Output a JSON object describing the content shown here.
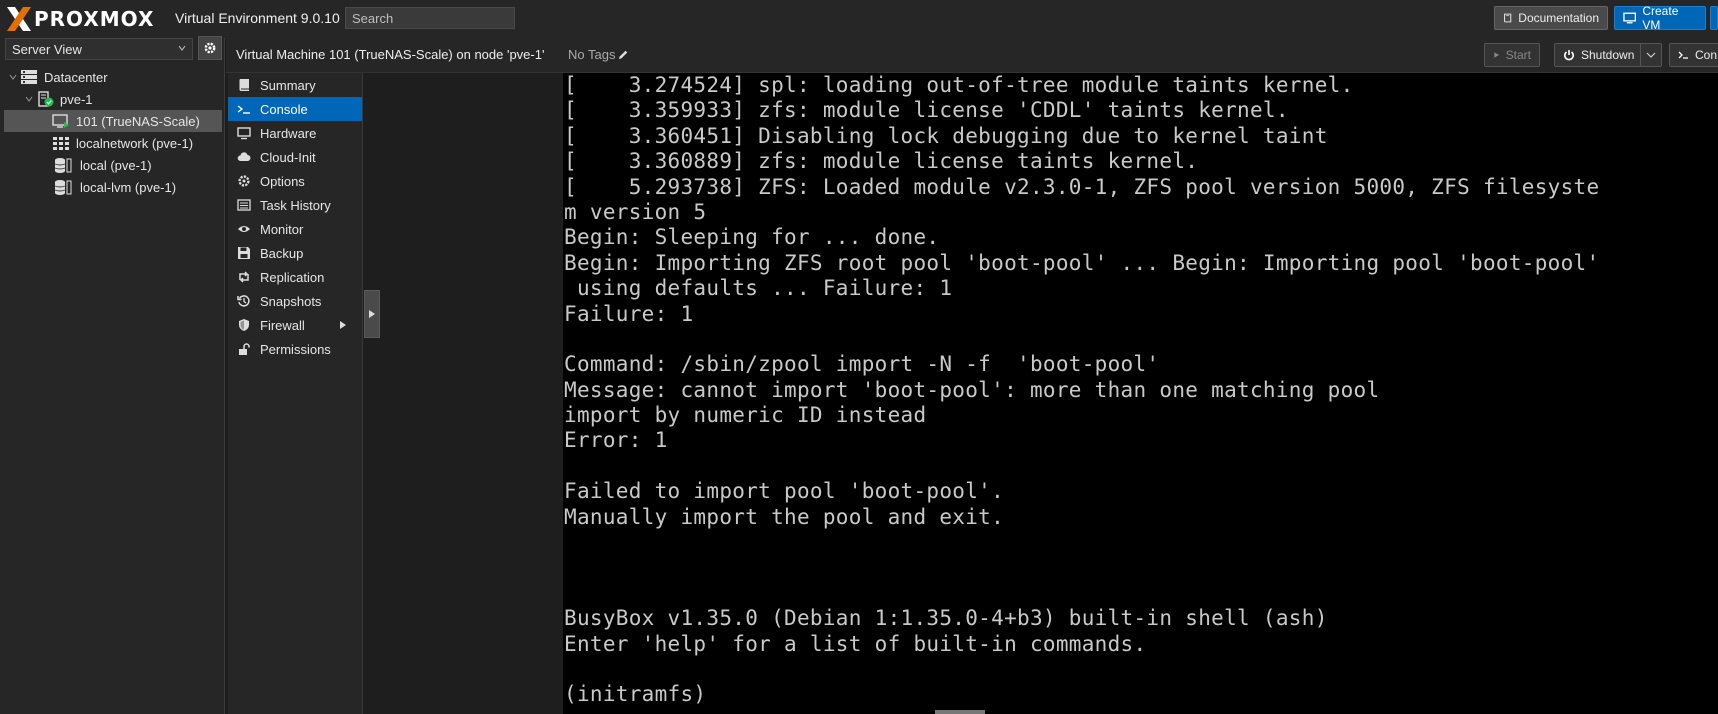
{
  "header": {
    "logo_text": "PROXMOX",
    "product": "Virtual Environment 9.0.10",
    "search_placeholder": "Search",
    "documentation_label": "Documentation",
    "create_vm_label": "Create VM"
  },
  "sidebar": {
    "view_label": "Server View",
    "tree": [
      {
        "label": "Datacenter",
        "icon": "datacenter-icon"
      },
      {
        "label": "pve-1",
        "icon": "node-online-icon"
      },
      {
        "label": "101 (TrueNAS-Scale)",
        "icon": "vm-running-icon",
        "selected": true
      },
      {
        "label": "localnetwork (pve-1)",
        "icon": "sdn-icon"
      },
      {
        "label": "local (pve-1)",
        "icon": "storage-icon"
      },
      {
        "label": "local-lvm (pve-1)",
        "icon": "storage-icon"
      }
    ]
  },
  "content_header": {
    "title": "Virtual Machine 101 (TrueNAS-Scale) on node 'pve-1'",
    "tags": "No Tags",
    "start_label": "Start",
    "shutdown_label": "Shutdown",
    "console_label": "Con"
  },
  "vm_menu": [
    {
      "label": "Summary",
      "icon": "book-icon"
    },
    {
      "label": "Console",
      "icon": "terminal-icon",
      "selected": true
    },
    {
      "label": "Hardware",
      "icon": "monitor-icon"
    },
    {
      "label": "Cloud-Init",
      "icon": "cloud-icon"
    },
    {
      "label": "Options",
      "icon": "gear-icon"
    },
    {
      "label": "Task History",
      "icon": "list-icon"
    },
    {
      "label": "Monitor",
      "icon": "eye-icon"
    },
    {
      "label": "Backup",
      "icon": "floppy-icon"
    },
    {
      "label": "Replication",
      "icon": "retweet-icon"
    },
    {
      "label": "Snapshots",
      "icon": "history-icon"
    },
    {
      "label": "Firewall",
      "icon": "shield-icon",
      "has_submenu": true
    },
    {
      "label": "Permissions",
      "icon": "unlock-icon"
    }
  ],
  "console": {
    "lines": [
      "[    3.274524] spl: loading out-of-tree module taints kernel.",
      "[    3.359933] zfs: module license 'CDDL' taints kernel.",
      "[    3.360451] Disabling lock debugging due to kernel taint",
      "[    3.360889] zfs: module license taints kernel.",
      "[    5.293738] ZFS: Loaded module v2.3.0-1, ZFS pool version 5000, ZFS filesyste",
      "m version 5",
      "Begin: Sleeping for ... done.",
      "Begin: Importing ZFS root pool 'boot-pool' ... Begin: Importing pool 'boot-pool'",
      " using defaults ... Failure: 1",
      "Failure: 1",
      "",
      "Command: /sbin/zpool import -N -f  'boot-pool'",
      "Message: cannot import 'boot-pool': more than one matching pool",
      "import by numeric ID instead",
      "Error: 1",
      "",
      "Failed to import pool 'boot-pool'.",
      "Manually import the pool and exit.",
      "",
      "",
      "",
      "BusyBox v1.35.0 (Debian 1:1.35.0-4+b3) built-in shell (ash)",
      "Enter 'help' for a list of built-in commands.",
      "",
      "(initramfs)"
    ]
  }
}
